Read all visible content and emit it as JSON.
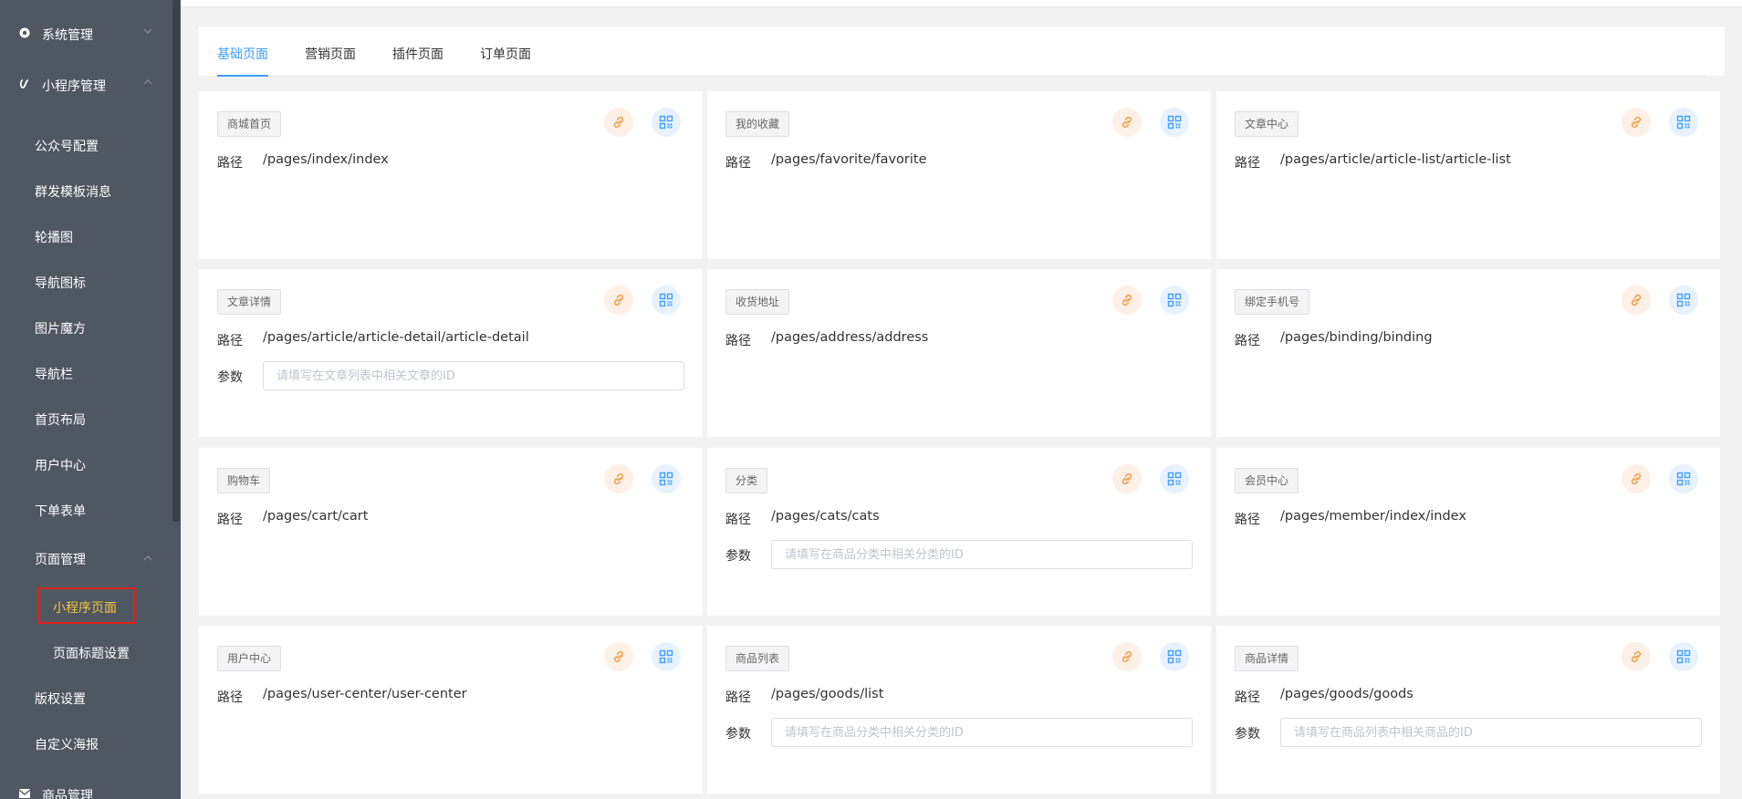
{
  "sidebar": {
    "system": "系统管理",
    "miniapp": "小程序管理",
    "items": [
      "公众号配置",
      "群发模板消息",
      "轮播图",
      "导航图标",
      "图片魔方",
      "导航栏",
      "首页布局",
      "用户中心",
      "下单表单"
    ],
    "page_mgmt": "页面管理",
    "sub_items": [
      "小程序页面",
      "页面标题设置"
    ],
    "items_after": [
      "版权设置",
      "自定义海报"
    ],
    "goods": "商品管理"
  },
  "tabs": [
    "基础页面",
    "营销页面",
    "插件页面",
    "订单页面"
  ],
  "labels": {
    "path": "路径",
    "param": "参数"
  },
  "cards": [
    {
      "tag": "商城首页",
      "path": "/pages/index/index"
    },
    {
      "tag": "我的收藏",
      "path": "/pages/favorite/favorite"
    },
    {
      "tag": "文章中心",
      "path": "/pages/article/article-list/article-list"
    },
    {
      "tag": "文章详情",
      "path": "/pages/article/article-detail/article-detail",
      "param_placeholder": "请填写在文章列表中相关文章的ID"
    },
    {
      "tag": "收货地址",
      "path": "/pages/address/address"
    },
    {
      "tag": "绑定手机号",
      "path": "/pages/binding/binding"
    },
    {
      "tag": "购物车",
      "path": "/pages/cart/cart"
    },
    {
      "tag": "分类",
      "path": "/pages/cats/cats",
      "param_placeholder": "请填写在商品分类中相关分类的ID"
    },
    {
      "tag": "会员中心",
      "path": "/pages/member/index/index"
    },
    {
      "tag": "用户中心",
      "path": "/pages/user-center/user-center"
    },
    {
      "tag": "商品列表",
      "path": "/pages/goods/list",
      "param_placeholder": "请填写在商品分类中相关分类的ID"
    },
    {
      "tag": "商品详情",
      "path": "/pages/goods/goods",
      "param_placeholder": "请填写在商品列表中相关商品的ID"
    }
  ],
  "colors": {
    "sidebar_bg": "#4f5761",
    "active_menu": "#f5c445",
    "tab_active": "#409eff",
    "link_icon": "#f0a050",
    "qr_icon": "#409eff",
    "highlight_box": "#e0201c"
  }
}
